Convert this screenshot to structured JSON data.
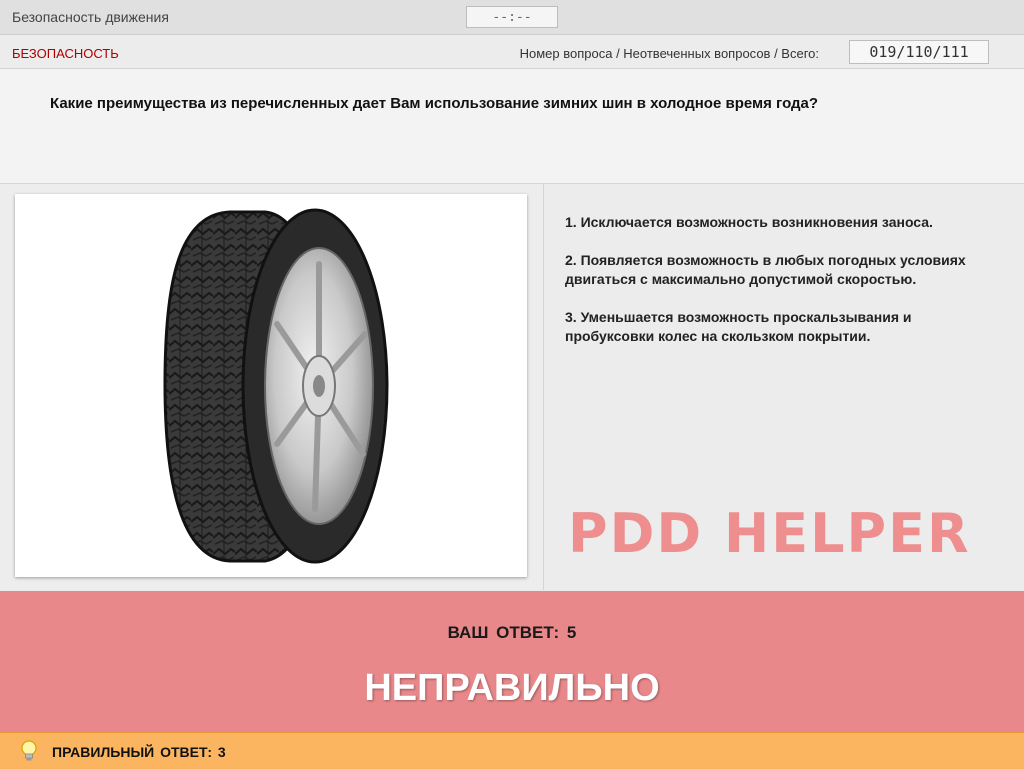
{
  "app": {
    "title": "Безопасность движения",
    "timer": "--:--"
  },
  "header": {
    "category": "БЕЗОПАСНОСТЬ",
    "counter_label": "Номер вопроса / Неотвеченных вопросов / Всего:",
    "counter_value": "019/110/111"
  },
  "question": {
    "text": "Какие преимущества из перечисленных дает Вам использование зимних шин в холодное время года?",
    "image": "winter-tire-photo"
  },
  "answers": [
    {
      "label": "1.  Исключается возможность возникновения заноса."
    },
    {
      "label": "2.  Появляется возможность в любых погодных условиях двигаться с максимально допустимой скоростью."
    },
    {
      "label": "3.  Уменьшается возможность проскальзывания и пробуксовки колес на скользком покрытии."
    }
  ],
  "watermark": "PDD HELPER",
  "result": {
    "your_answer": "ВАШ  ОТВЕТ:   5",
    "verdict": "НЕПРАВИЛЬНО",
    "correct_answer": "ПРАВИЛЬНЫЙ ОТВЕТ:   3",
    "hint_icon": "lightbulb-icon"
  },
  "colors": {
    "result_bg": "#e8888a",
    "correct_bg": "#fbb560",
    "category_color": "#b00000",
    "watermark_color": "#ee8e8e"
  }
}
